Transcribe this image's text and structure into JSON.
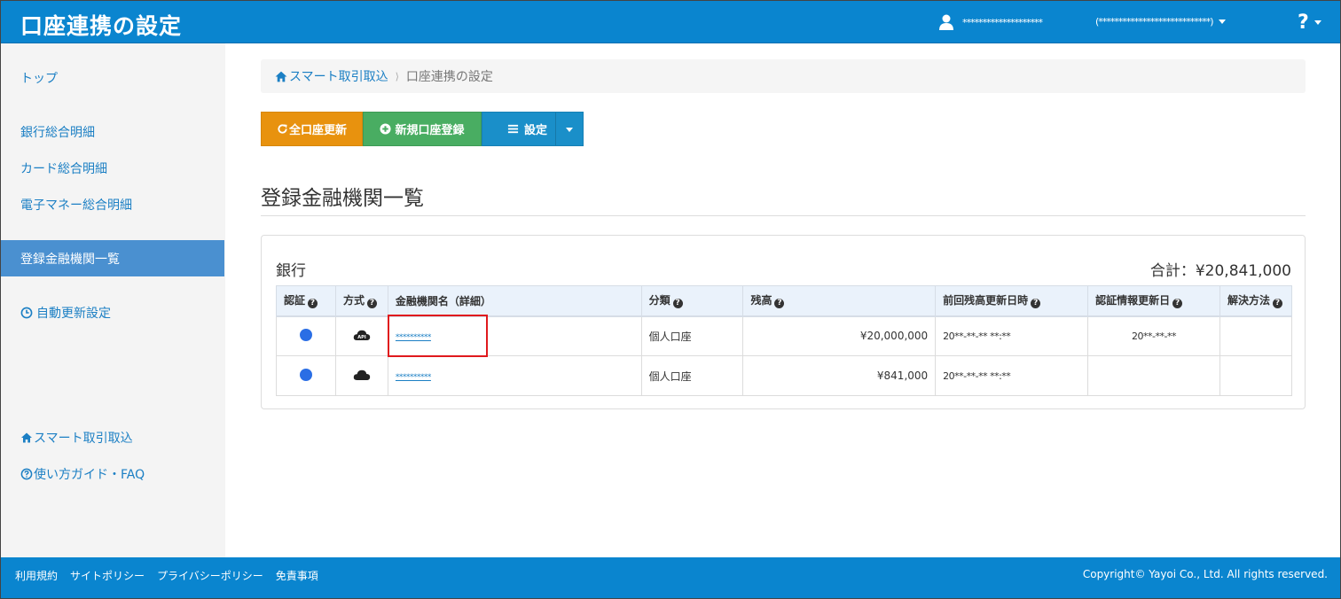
{
  "header": {
    "title": "口座連携の設定",
    "user_name": "********************",
    "user_org": "(****************************)",
    "help": "?"
  },
  "sidebar": {
    "items": [
      {
        "label": "トップ"
      },
      {
        "label": "銀行総合明細"
      },
      {
        "label": "カード総合明細"
      },
      {
        "label": "電子マネー総合明細"
      },
      {
        "label": "登録金融機関一覧"
      },
      {
        "label": "自動更新設定"
      },
      {
        "label": "スマート取引取込"
      },
      {
        "label": "使い方ガイド・FAQ"
      }
    ]
  },
  "breadcrumb": {
    "home": "スマート取引取込",
    "current": "口座連携の設定"
  },
  "toolbar": {
    "refresh_all": "全口座更新",
    "new_account": "新規口座登録",
    "settings": "設定"
  },
  "page": {
    "section_title": "登録金融機関一覧"
  },
  "panel": {
    "title": "銀行",
    "total": "合計：¥20,841,000",
    "columns": [
      "認証",
      "方式",
      "金融機関名（詳細）",
      "分類",
      "残高",
      "前回残高更新日時",
      "認証情報更新日",
      "解決方法"
    ],
    "rows": [
      {
        "method": "API",
        "name": "**********",
        "category": "個人口座",
        "balance": "¥20,000,000",
        "last_update": "20**-**-** **:**",
        "auth_update": "20**-**-**",
        "resolution": ""
      },
      {
        "method": "",
        "name": "**********",
        "category": "個人口座",
        "balance": "¥841,000",
        "last_update": "20**-**-** **:**",
        "auth_update": "",
        "resolution": ""
      }
    ]
  },
  "footer": {
    "links": [
      "利用規約",
      "サイトポリシー",
      "プライバシーポリシー",
      "免責事項"
    ],
    "copyright": "Copyright© Yayoi Co., Ltd. All rights reserved."
  },
  "colors": {
    "brand_blue": "#0a85cf",
    "orange": "#e8920e",
    "green": "#49ad62",
    "sidebar_active": "#4a90d0",
    "status_dot": "#2a6ee5",
    "highlight": "#e0191d"
  },
  "icons": [
    "user-icon",
    "help-icon",
    "home-icon",
    "clock-icon",
    "refresh-icon",
    "plus-circle-icon",
    "menu-icon",
    "question-circle-icon",
    "cloud-api-icon",
    "cloud-icon"
  ]
}
